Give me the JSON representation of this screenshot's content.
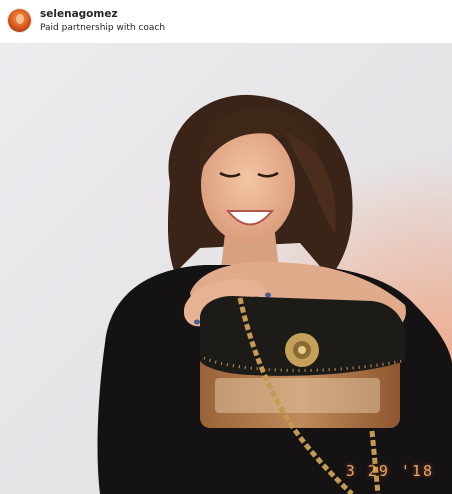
{
  "post": {
    "username": "selenagomez",
    "subtitle": "Paid partnership with coach",
    "date_stamp": "3 29 '18"
  },
  "icons": {
    "avatar": "profile-avatar"
  },
  "colors": {
    "header_bg": "#ffffff",
    "text": "#262626",
    "wall": "#e9e8ea",
    "sweater": "#151214",
    "bag_flap": "#1d1b18",
    "bag_leather": "#b07a4e",
    "chain": "#c29a52"
  }
}
